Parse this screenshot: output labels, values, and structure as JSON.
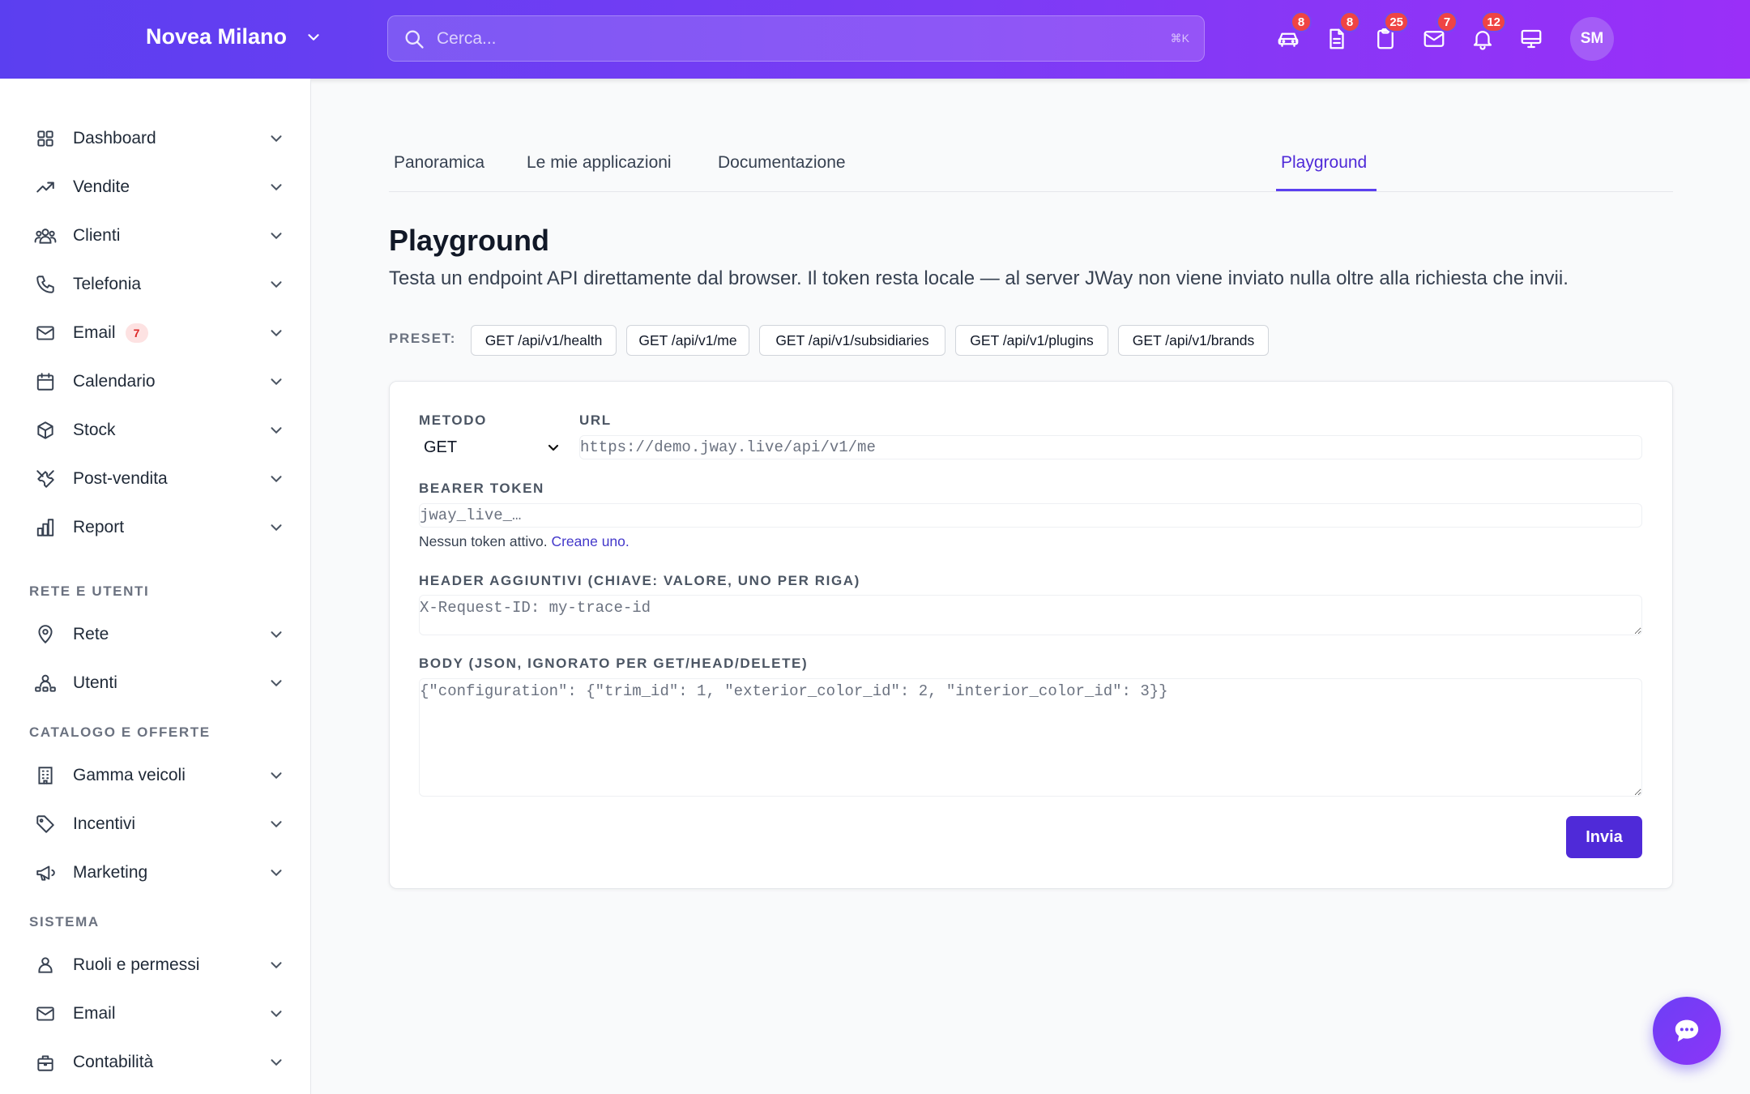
{
  "header": {
    "org_name": "Novea Milano",
    "search_placeholder": "Cerca...",
    "search_shortcut": "⌘K",
    "icons": [
      {
        "name": "car-icon",
        "badge": "8"
      },
      {
        "name": "document-icon",
        "badge": "8"
      },
      {
        "name": "clipboard-icon",
        "badge": "25"
      },
      {
        "name": "mail-icon",
        "badge": "7"
      },
      {
        "name": "bell-icon",
        "badge": "12"
      },
      {
        "name": "monitor-icon",
        "badge": ""
      }
    ],
    "avatar_initials": "SM"
  },
  "sidebar": {
    "items": [
      {
        "label": "Dashboard",
        "icon": "grid-icon"
      },
      {
        "label": "Vendite",
        "icon": "trending-up-icon"
      },
      {
        "label": "Clienti",
        "icon": "users-icon"
      },
      {
        "label": "Telefonia",
        "icon": "phone-icon"
      },
      {
        "label": "Email",
        "icon": "mail-icon",
        "badge": "7"
      },
      {
        "label": "Calendario",
        "icon": "calendar-icon"
      },
      {
        "label": "Stock",
        "icon": "cube-icon"
      },
      {
        "label": "Post-vendita",
        "icon": "wrench-icon"
      },
      {
        "label": "Report",
        "icon": "bar-chart-icon"
      }
    ],
    "sections": [
      {
        "title": "RETE E UTENTI",
        "items": [
          {
            "label": "Rete",
            "icon": "map-pin-icon"
          },
          {
            "label": "Utenti",
            "icon": "user-network-icon"
          }
        ]
      },
      {
        "title": "CATALOGO E OFFERTE",
        "items": [
          {
            "label": "Gamma veicoli",
            "icon": "building-icon"
          },
          {
            "label": "Incentivi",
            "icon": "tag-icon"
          },
          {
            "label": "Marketing",
            "icon": "megaphone-icon"
          }
        ]
      },
      {
        "title": "SISTEMA",
        "items": [
          {
            "label": "Ruoli e permessi",
            "icon": "user-icon"
          },
          {
            "label": "Email",
            "icon": "mail-icon"
          },
          {
            "label": "Contabilità",
            "icon": "briefcase-icon"
          }
        ]
      }
    ]
  },
  "tabs": [
    {
      "label": "Panoramica",
      "active": false
    },
    {
      "label": "Le mie applicazioni",
      "active": false
    },
    {
      "label": "Documentazione",
      "active": false
    },
    {
      "label": "Playground",
      "active": true
    }
  ],
  "page": {
    "title": "Playground",
    "description": "Testa un endpoint API direttamente dal browser. Il token resta locale — al server JWay non viene inviato nulla oltre alla richiesta che invii."
  },
  "presets": {
    "label": "PRESET:",
    "items": [
      "GET /api/v1/health",
      "GET /api/v1/me",
      "GET /api/v1/subsidiaries",
      "GET /api/v1/plugins",
      "GET /api/v1/brands"
    ]
  },
  "form": {
    "method_label": "METODO",
    "method_value": "GET",
    "url_label": "URL",
    "url_placeholder": "https://demo.jway.live/api/v1/me",
    "token_label": "BEARER TOKEN",
    "token_placeholder": "jway_live_…",
    "token_hint": "Nessun token attivo.",
    "token_hint_link": "Creane uno.",
    "headers_label": "HEADER AGGIUNTIVI (CHIAVE: VALORE, UNO PER RIGA)",
    "headers_placeholder": "X-Request-ID: my-trace-id",
    "body_label": "BODY (JSON, IGNORATO PER GET/HEAD/DELETE)",
    "body_placeholder": "{\"configuration\": {\"trim_id\": 1, \"exterior_color_id\": 2, \"interior_color_id\": 3}}",
    "submit_label": "Invia"
  },
  "colors": {
    "accent": "#4f2ad8",
    "header_gradient_start": "#5b3ff0",
    "header_gradient_end": "#9a2ff8",
    "badge": "#ef4444"
  }
}
